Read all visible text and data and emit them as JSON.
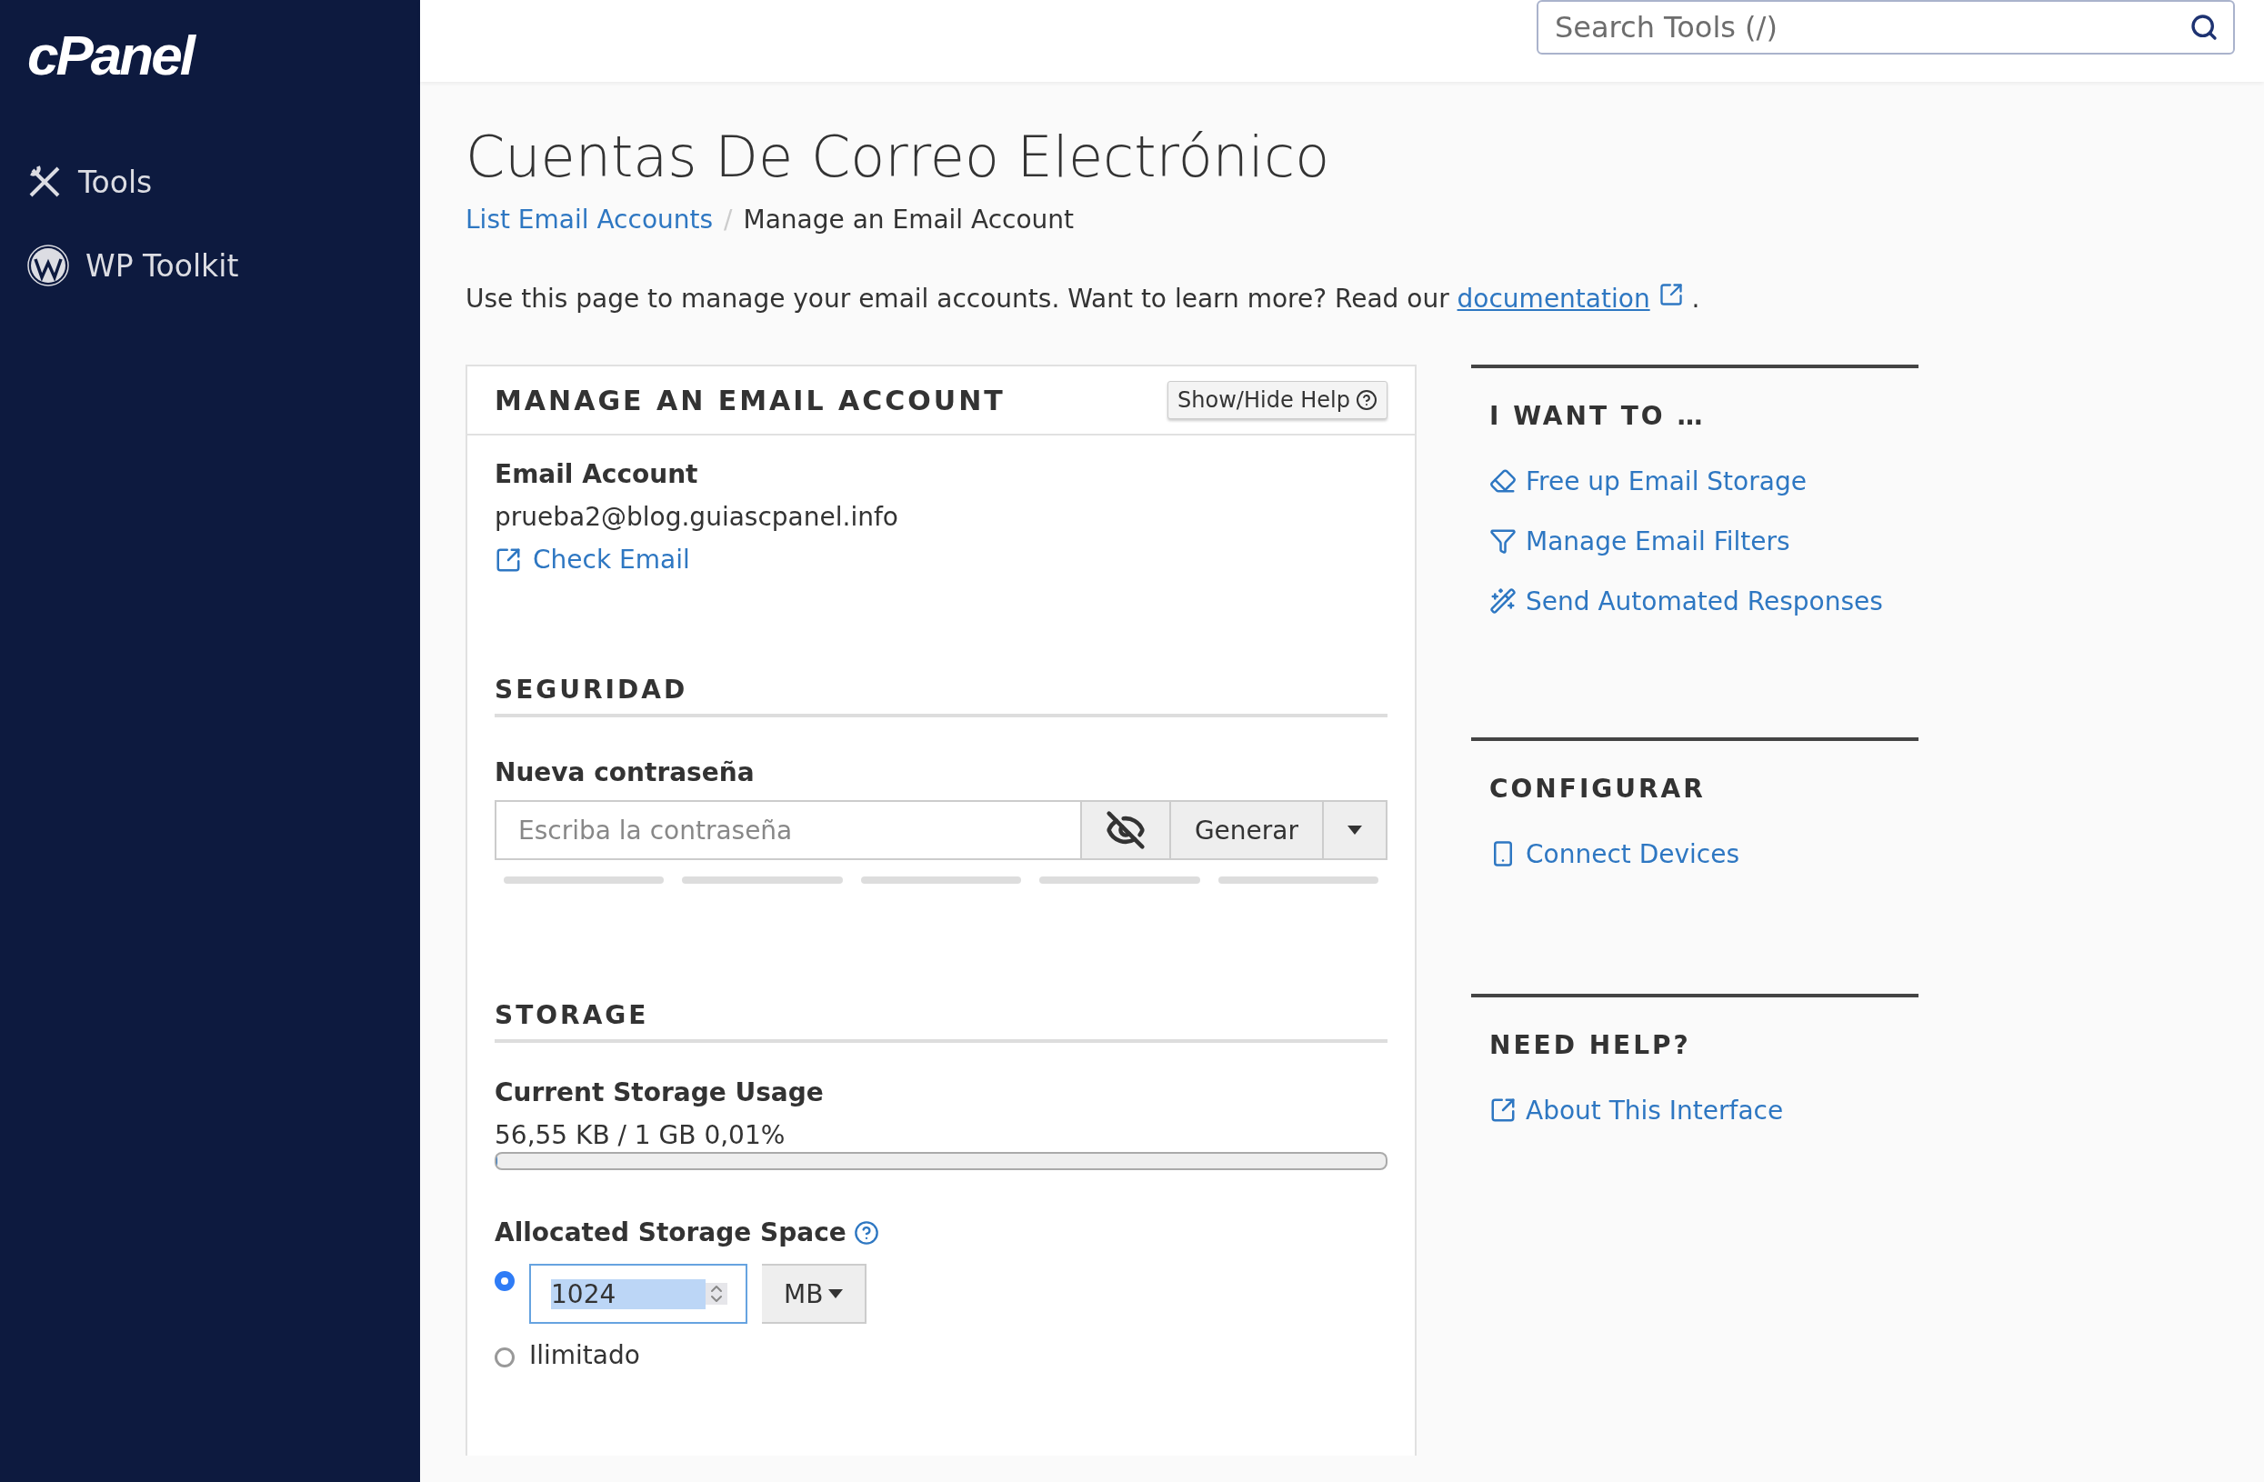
{
  "sidebar": {
    "logo": "cPanel",
    "items": [
      {
        "kind": "tools",
        "label": "Tools"
      },
      {
        "kind": "wordpress",
        "label": "WP Toolkit"
      }
    ]
  },
  "search": {
    "placeholder": "Search Tools (/)"
  },
  "page": {
    "title": "Cuentas De Correo Electrónico",
    "breadcrumbs": [
      {
        "kind": "link",
        "label": "List Email Accounts"
      },
      {
        "kind": "current",
        "label": "Manage an Email Account"
      }
    ],
    "breadcrumb_separator": "/",
    "intro": "Use this page to manage your email accounts. Want to learn more? Read our ",
    "intro_link": "documentation",
    "intro_end": "."
  },
  "card": {
    "title": "MANAGE AN EMAIL ACCOUNT",
    "help_button": "Show/Hide Help",
    "account_label": "Email Account",
    "account": "prueba2@blog.guiascpanel.info",
    "check_email": "Check Email",
    "security": {
      "heading": "SEGURIDAD",
      "label": "Nueva contraseña",
      "placeholder": "Escriba la contraseña",
      "generate": "Generar"
    },
    "storage": {
      "heading": "STORAGE",
      "usage_label": "Current Storage Usage",
      "usage": "56,55 KB / 1 GB 0,01%",
      "usage_bar": {
        "level": 0.0001
      },
      "allocated_label": "Allocated Storage Space",
      "options": [
        {
          "kind": "quota",
          "selected": true,
          "value": "1024",
          "unit": "MB"
        },
        {
          "kind": "unlimited",
          "selected": false,
          "label": "Ilimitado"
        }
      ]
    }
  },
  "aside": [
    {
      "title": "I WANT TO …",
      "links": [
        {
          "kind": "eraser",
          "label": "Free up Email Storage"
        },
        {
          "kind": "filter",
          "label": "Manage Email Filters"
        },
        {
          "kind": "wand",
          "label": "Send Automated Responses"
        }
      ]
    },
    {
      "title": "CONFIGURAR",
      "links": [
        {
          "kind": "phone",
          "label": "Connect Devices"
        }
      ]
    },
    {
      "title": "NEED HELP?",
      "links": [
        {
          "kind": "external",
          "label": "About This Interface"
        }
      ]
    }
  ]
}
